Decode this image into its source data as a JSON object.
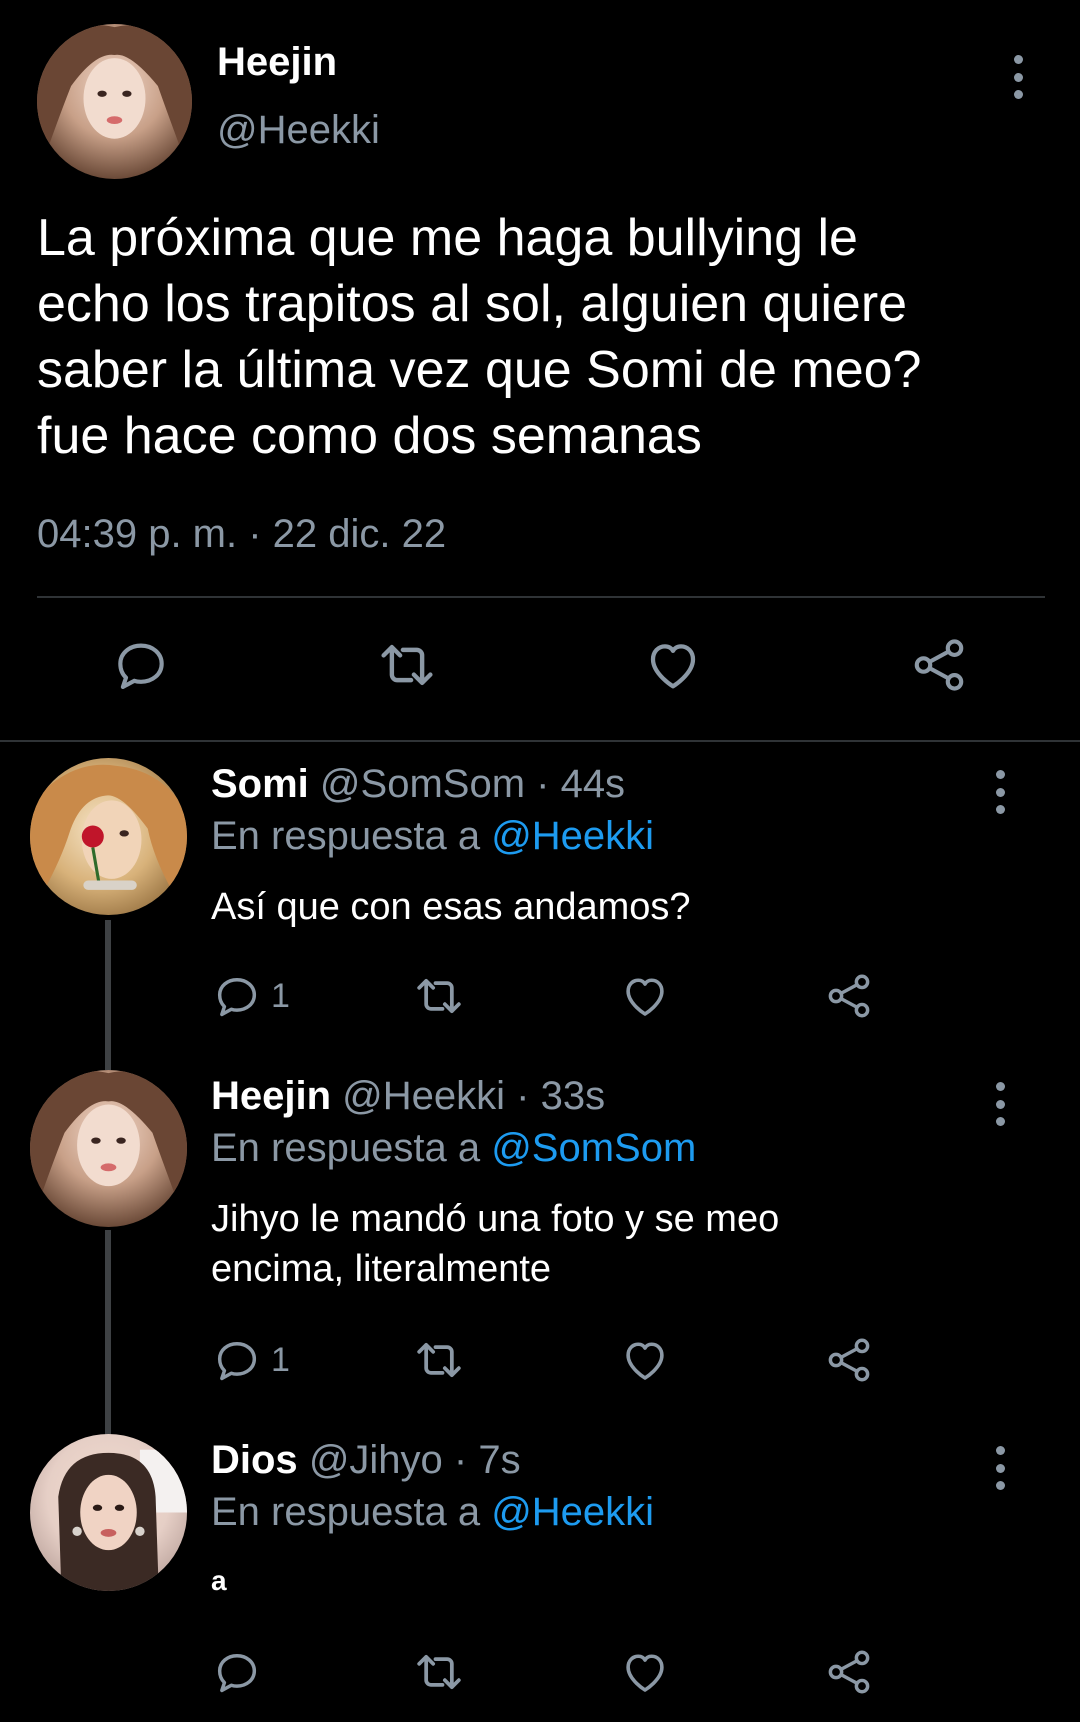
{
  "main": {
    "name": "Heejin",
    "handle": "@Heekki",
    "text": "La próxima que me haga bullying le\necho los trapitos al sol, alguien quiere\nsaber la última vez que Somi de meo?\nfue hace como dos semanas",
    "timestamp": "04:39 p. m. · 22 dic. 22",
    "actions": [
      "reply-icon",
      "retweet-icon",
      "like-icon",
      "share-icon"
    ]
  },
  "replies": [
    {
      "name": "Somi",
      "meta": "@SomSom · 44s",
      "in_reply_prefix": "En respuesta a ",
      "in_reply_to": "@Heekki",
      "text": "Así que con esas andamos?",
      "reply_count": "1"
    },
    {
      "name": "Heejin",
      "meta": "@Heekki · 33s",
      "in_reply_prefix": "En respuesta a ",
      "in_reply_to": "@SomSom",
      "text": "Jihyo le mandó una foto y se meo encima, literalmente",
      "reply_count": "1"
    },
    {
      "name": "Dios",
      "meta": "@Jihyo · 7s",
      "in_reply_prefix": "En respuesta a ",
      "in_reply_to": "@Heekki",
      "text": "a",
      "reply_count": ""
    }
  ],
  "colors": {
    "background": "#000000",
    "muted": "#8b98a5",
    "link": "#1d9bf0",
    "divider": "#2f3336"
  }
}
